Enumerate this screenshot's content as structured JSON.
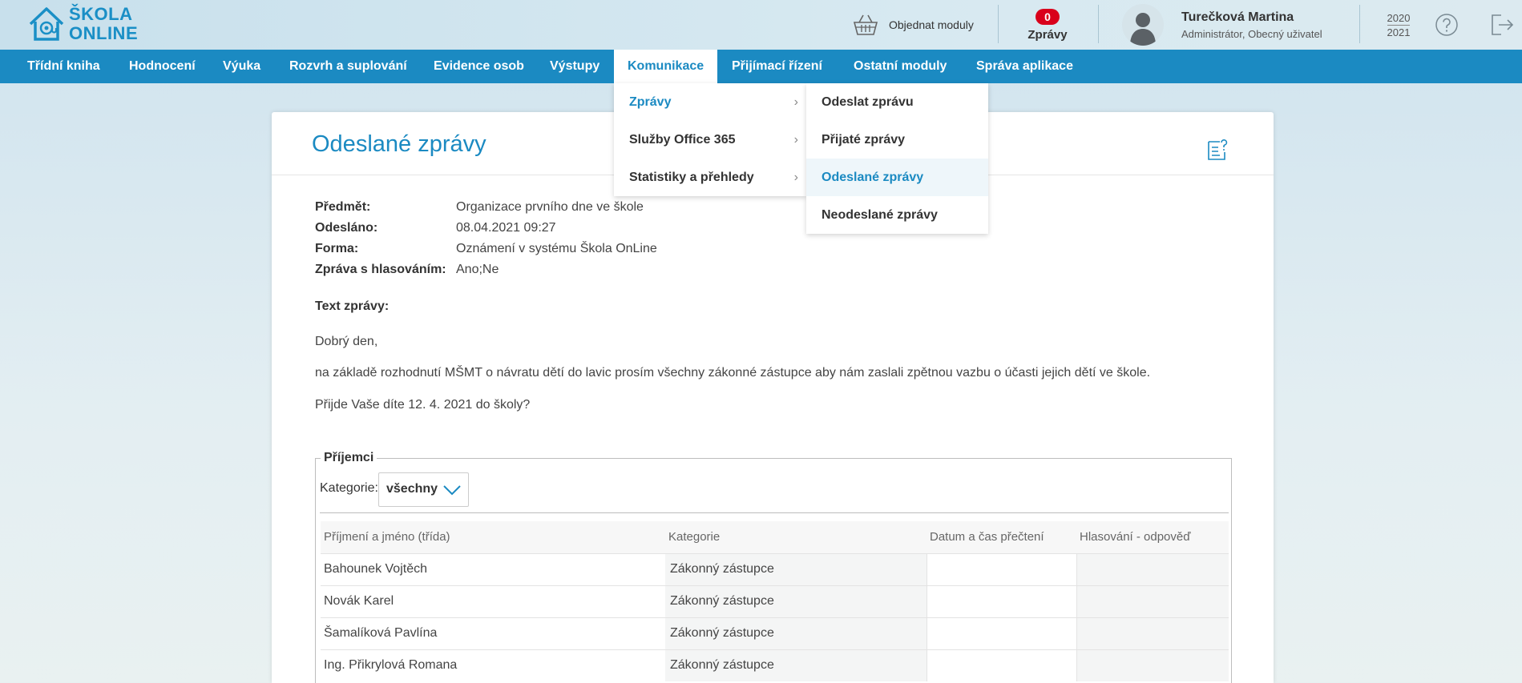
{
  "header": {
    "logo": {
      "line1": "ŠKOLA",
      "line2": "ONLINE"
    },
    "order_modules_label": "Objednat moduly",
    "messages": {
      "count": "0",
      "label": "Zprávy"
    },
    "user": {
      "name": "Turečková Martina",
      "role": "Administrátor, Obecný uživatel"
    },
    "years": {
      "from": "2020",
      "to": "2021"
    }
  },
  "nav": {
    "items": [
      {
        "label": "Třídní kniha"
      },
      {
        "label": "Hodnocení"
      },
      {
        "label": "Výuka"
      },
      {
        "label": "Rozvrh a suplování"
      },
      {
        "label": "Evidence osob"
      },
      {
        "label": "Výstupy"
      },
      {
        "label": "Komunikace",
        "active": true
      },
      {
        "label": "Přijímací řízení"
      },
      {
        "label": "Ostatní moduly"
      },
      {
        "label": "Správa aplikace"
      }
    ]
  },
  "submenu": {
    "items": [
      {
        "label": "Zprávy",
        "active": true
      },
      {
        "label": "Služby Office 365"
      },
      {
        "label": "Statistiky a přehledy"
      }
    ],
    "chevron": "›"
  },
  "submenu2": {
    "items": [
      {
        "label": "Odeslat zprávu"
      },
      {
        "label": "Přijaté zprávy"
      },
      {
        "label": "Odeslané zprávy",
        "active": true
      },
      {
        "label": "Neodeslané zprávy"
      }
    ]
  },
  "page": {
    "title": "Odeslané zprávy",
    "meta": {
      "subject_label": "Předmět:",
      "subject": "Organizace prvního dne ve škole",
      "sent_label": "Odesláno:",
      "sent": "08.04.2021 09:27",
      "form_label": "Forma:",
      "form": "Oznámení v systému Škola OnLine",
      "voting_label": "Zpráva s hlasováním:",
      "voting": "Ano;Ne"
    },
    "text_label": "Text zprávy:",
    "body": [
      "Dobrý den,",
      "na základě rozhodnutí MŠMT o návratu dětí do lavic prosím všechny zákonné zástupce aby nám zaslali zpětnou vazbu o účasti jejich dětí ve škole.",
      "Přijde Vaše díte 12. 4. 2021 do školy?"
    ]
  },
  "recipients": {
    "legend": "Příjemci",
    "category_label": "Kategorie:",
    "category_value": "všechny",
    "columns": [
      "Příjmení a jméno (třída)",
      "Kategorie",
      "Datum a čas přečtení",
      "Hlasování - odpověď"
    ],
    "rows": [
      {
        "name": "Bahounek Vojtěch",
        "category": "Zákonný zástupce",
        "read": "",
        "vote": ""
      },
      {
        "name": "Novák Karel",
        "category": "Zákonný zástupce",
        "read": "",
        "vote": ""
      },
      {
        "name": "Šamalíková Pavlína",
        "category": "Zákonný zástupce",
        "read": "",
        "vote": ""
      },
      {
        "name": "Ing. Přikrylová Romana",
        "category": "Zákonný zástupce",
        "read": "",
        "vote": ""
      }
    ]
  },
  "colors": {
    "accent": "#1b8ac2",
    "badge": "#d9001b",
    "logo": "#1a8fc6"
  },
  "icons": [
    "house-at-logo-icon",
    "basket-icon",
    "user-avatar-icon",
    "help-circle-icon",
    "logout-icon",
    "chevron-right-icon",
    "help-document-icon",
    "chevron-down-icon"
  ]
}
